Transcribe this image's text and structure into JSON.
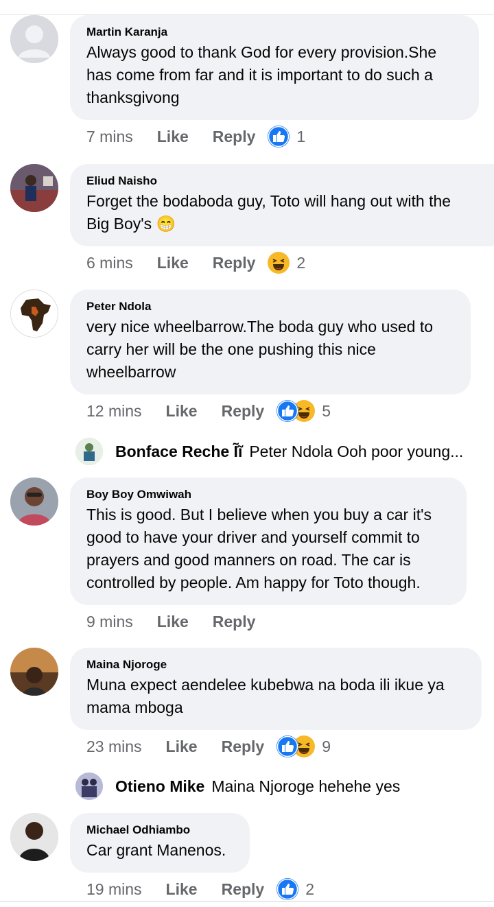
{
  "comments": [
    {
      "name": "Martin Karanja",
      "text": "Always good to thank God for every provision.She has come from far and it is important to do such a thanksgivong",
      "time": "7 mins",
      "like": "Like",
      "reply": "Reply",
      "reaction_icons": [
        "like-reaction-icon"
      ],
      "reaction_count": "1"
    },
    {
      "name": "Eliud Naisho",
      "text": "Forget the bodaboda guy, Toto will hang out with the Big Boy's 😁",
      "time": "6 mins",
      "like": "Like",
      "reply": "Reply",
      "reaction_icons": [
        "haha-reaction-icon"
      ],
      "reaction_count": "2"
    },
    {
      "name": "Peter Ndola",
      "text": "very nice wheelbarrow.The boda guy who used to carry her will be the one pushing this nice wheelbarrow",
      "time": "12 mins",
      "like": "Like",
      "reply": "Reply",
      "reaction_icons": [
        "like-reaction-icon",
        "haha-reaction-icon"
      ],
      "reaction_count": "5",
      "reply_preview": {
        "name": "Bonface Reche Ĩĩ",
        "text": "Peter Ndola Ooh poor young..."
      }
    },
    {
      "name": "Boy Boy Omwiwah",
      "text": "This is good. But I believe when you buy a car it's good to have your driver and yourself commit to prayers and good manners on road. The car is controlled by people.  Am happy for Toto though.",
      "time": "9 mins",
      "like": "Like",
      "reply": "Reply"
    },
    {
      "name": "Maina Njoroge",
      "text": "Muna expect aendelee kubebwa na boda ili ikue ya mama mboga",
      "time": "23 mins",
      "like": "Like",
      "reply": "Reply",
      "reaction_icons": [
        "like-reaction-icon",
        "haha-reaction-icon"
      ],
      "reaction_count": "9",
      "reply_preview": {
        "name": "Otieno Mike",
        "text": "Maina Njoroge hehehe yes"
      }
    },
    {
      "name": "Michael Odhiambo",
      "text": "Car grant Manenos.",
      "time": "19 mins",
      "like": "Like",
      "reply": "Reply",
      "reaction_icons": [
        "like-reaction-icon"
      ],
      "reaction_count": "2"
    }
  ],
  "colors": {
    "bubble_bg": "#f0f2f5",
    "meta_text": "#65676b",
    "like_blue": "#1877f2",
    "haha_yellow": "#f7b928"
  }
}
